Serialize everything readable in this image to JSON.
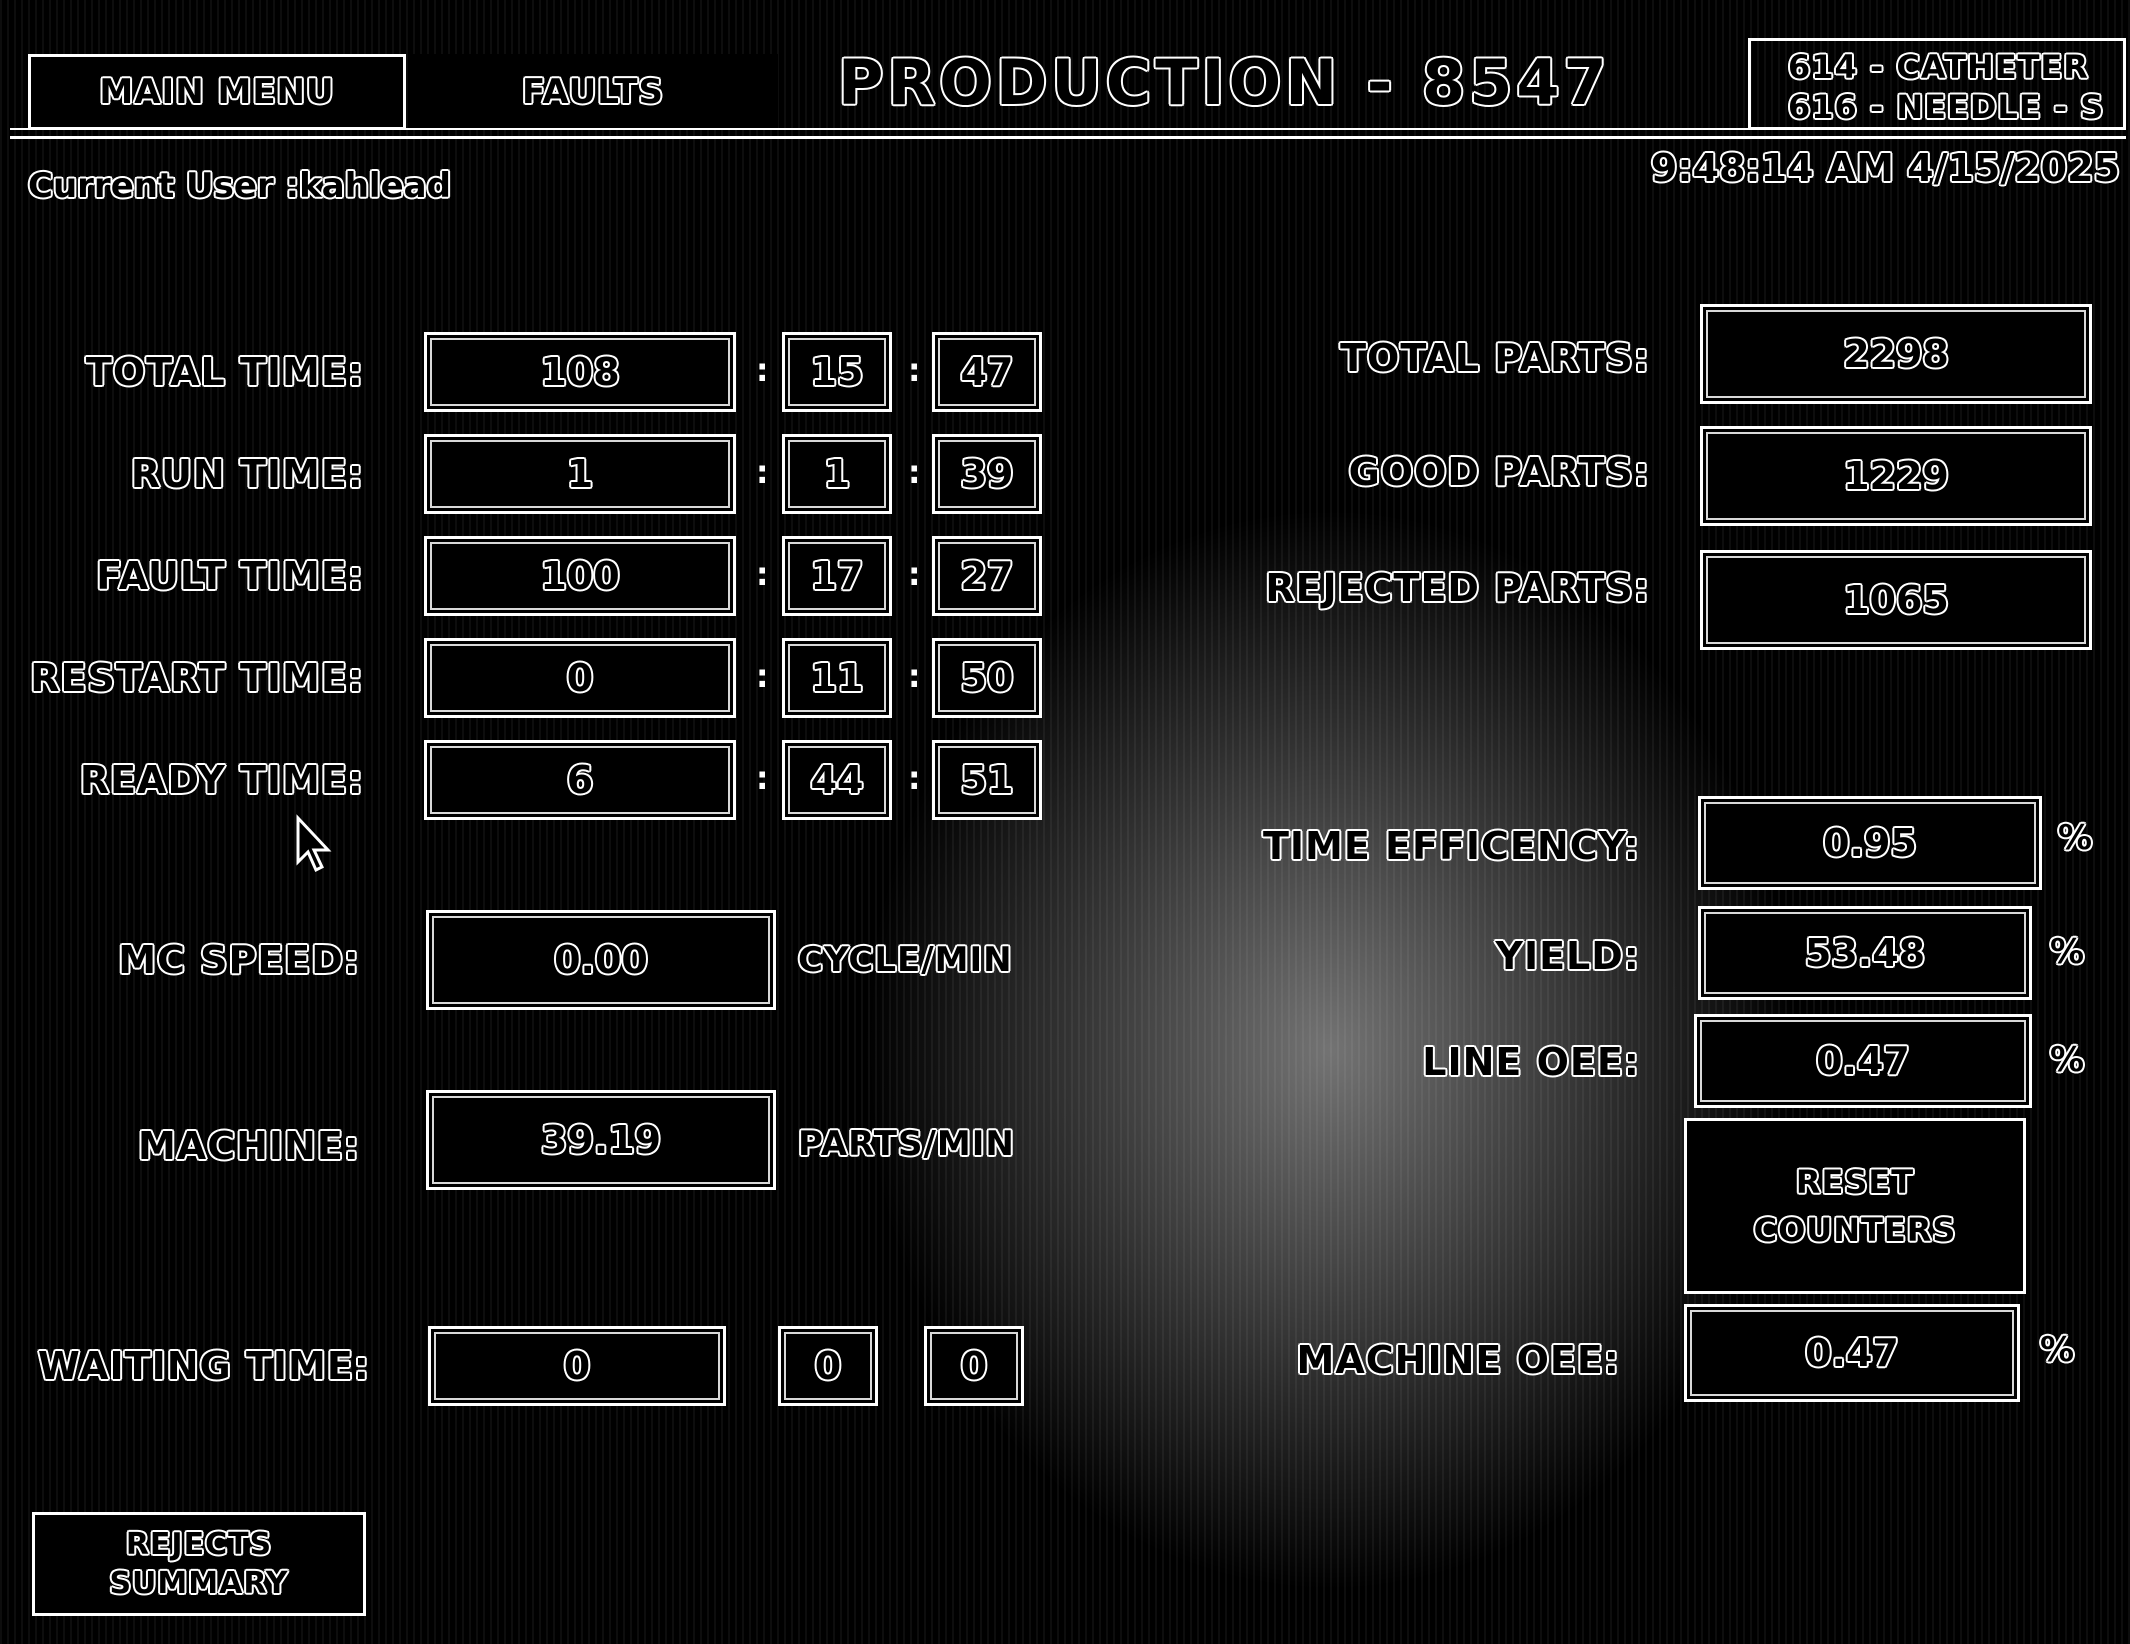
{
  "header": {
    "main_menu_label": "MAIN MENU",
    "faults_label": "FAULTS",
    "title": "PRODUCTION - 8547",
    "product_line_1": "614 - CATHETER",
    "product_line_2": "616 - NEEDLE - S"
  },
  "status": {
    "current_user": "Current User :kahlead",
    "datetime": "9:48:14 AM 4/15/2025"
  },
  "times": {
    "total": {
      "label": "TOTAL TIME:",
      "h": "108",
      "m": "15",
      "s": "47"
    },
    "run": {
      "label": "RUN TIME:",
      "h": "1",
      "m": "1",
      "s": "39"
    },
    "fault": {
      "label": "FAULT TIME:",
      "h": "100",
      "m": "17",
      "s": "27"
    },
    "restart": {
      "label": "RESTART TIME:",
      "h": "0",
      "m": "11",
      "s": "50"
    },
    "ready": {
      "label": "READY TIME:",
      "h": "6",
      "m": "44",
      "s": "51"
    },
    "waiting": {
      "label": "WAITING TIME:",
      "h": "0",
      "m": "0",
      "s": "0"
    }
  },
  "speed": {
    "mc_label": "MC SPEED:",
    "mc_value": "0.00",
    "mc_unit": "CYCLE/MIN",
    "machine_label": "MACHINE:",
    "machine_value": "39.19",
    "machine_unit": "PARTS/MIN"
  },
  "parts": {
    "total_label": "TOTAL PARTS:",
    "total_value": "2298",
    "good_label": "GOOD PARTS:",
    "good_value": "1229",
    "rejected_label": "REJECTED PARTS:",
    "rejected_value": "1065"
  },
  "metrics": {
    "time_eff_label": "TIME EFFICENCY:",
    "time_eff_value": "0.95",
    "time_eff_unit": "%",
    "yield_label": "YIELD:",
    "yield_value": "53.48",
    "yield_unit": "%",
    "line_oee_label": "LINE OEE:",
    "line_oee_value": "0.47",
    "line_oee_unit": "%",
    "machine_oee_label": "MACHINE OEE:",
    "machine_oee_value": "0.47",
    "machine_oee_unit": "%"
  },
  "buttons": {
    "reset_line_1": "RESET",
    "reset_line_2": "COUNTERS",
    "rejects_line_1": "REJECTS",
    "rejects_line_2": "SUMMARY"
  }
}
